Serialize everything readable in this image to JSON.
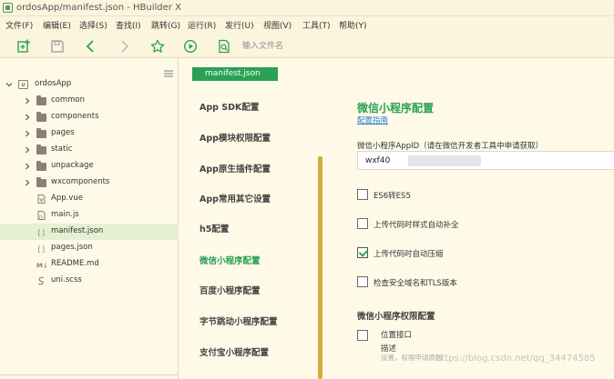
{
  "window": {
    "title": "ordosApp/manifest.json - HBuilder X"
  },
  "menu": [
    "文件(F)",
    "编辑(E)",
    "选择(S)",
    "查找(I)",
    "跳转(G)",
    "运行(R)",
    "发行(U)",
    "视图(V)",
    "工具(T)",
    "帮助(Y)"
  ],
  "toolbar": {
    "search_placeholder": "输入文件名"
  },
  "tree": {
    "root": "ordosApp",
    "items": [
      "common",
      "components",
      "pages",
      "static",
      "unpackage",
      "wxcomponents",
      "App.vue",
      "main.js",
      "manifest.json",
      "pages.json",
      "README.md",
      "uni.scss"
    ]
  },
  "editor": {
    "tab": "manifest.json"
  },
  "nav": {
    "items": [
      "App SDK配置",
      "App模块权限配置",
      "App原生插件配置",
      "App常用其它设置",
      "h5配置",
      "微信小程序配置",
      "百度小程序配置",
      "字节跳动小程序配置",
      "支付宝小程序配置"
    ]
  },
  "content": {
    "title": "微信小程序配置",
    "link": "配置指南",
    "appid_label": "微信小程序AppID（请在微信开发者工具中申请获取）",
    "appid_value": "wxf40",
    "checkboxes": [
      {
        "label": "ES6转ES5",
        "checked": false
      },
      {
        "label": "上传代码时样式自动补全",
        "checked": false
      },
      {
        "label": "上传代码时自动压缩",
        "checked": true
      },
      {
        "label": "检查安全域名和TLS版本",
        "checked": false
      }
    ],
    "perm_title": "微信小程序权限配置",
    "perm_item": {
      "label": "位置接口",
      "checked": false
    },
    "perm_desc": "描述",
    "perm_desc_sub": "设置，权限申请原因"
  },
  "watermark": "https://blog.csdn.net/qq_34474585",
  "colors": {
    "accent": "#2aa155",
    "background": "#fffae8",
    "link": "#2a7fd4",
    "scrollbar": "#d4ae3c"
  }
}
